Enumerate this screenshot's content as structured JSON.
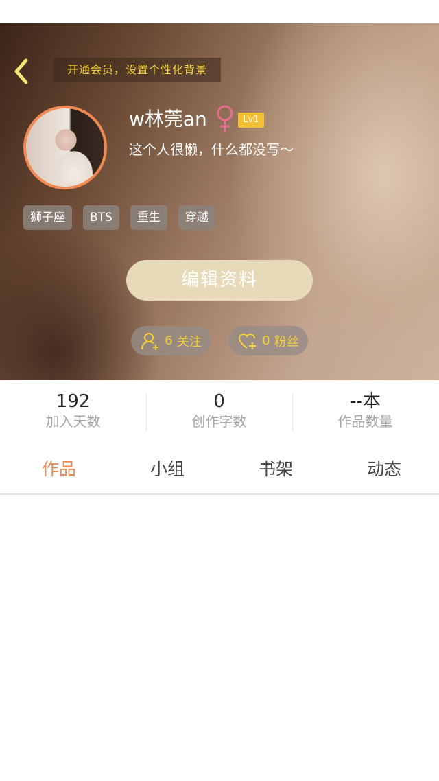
{
  "header": {
    "vip_banner": "开通会员，设置个性化背景"
  },
  "profile": {
    "username": "w林莞an",
    "gender_symbol": "♀",
    "level": "Lv1",
    "bio": "这个人很懒，什么都没写～",
    "tags": [
      "狮子座",
      "BTS",
      "重生",
      "穿越"
    ],
    "edit_button": "编辑资料",
    "follow": {
      "count": "6",
      "label": "关注"
    },
    "fans": {
      "count": "0",
      "label": "粉丝"
    }
  },
  "stats": [
    {
      "value": "192",
      "label": "加入天数"
    },
    {
      "value": "0",
      "label": "创作字数"
    },
    {
      "value": "--本",
      "label": "作品数量"
    }
  ],
  "tabs": [
    {
      "label": "作品",
      "active": true
    },
    {
      "label": "小组",
      "active": false
    },
    {
      "label": "书架",
      "active": false
    },
    {
      "label": "动态",
      "active": false
    }
  ],
  "colors": {
    "accent": "#f08a55",
    "vip_text": "#f4d13a",
    "level_badge": "#f3bf34",
    "gender": "#e6708f"
  },
  "icons": {
    "back": "back-chevron-icon",
    "follow": "user-plus-icon",
    "fans": "heart-plus-icon"
  }
}
